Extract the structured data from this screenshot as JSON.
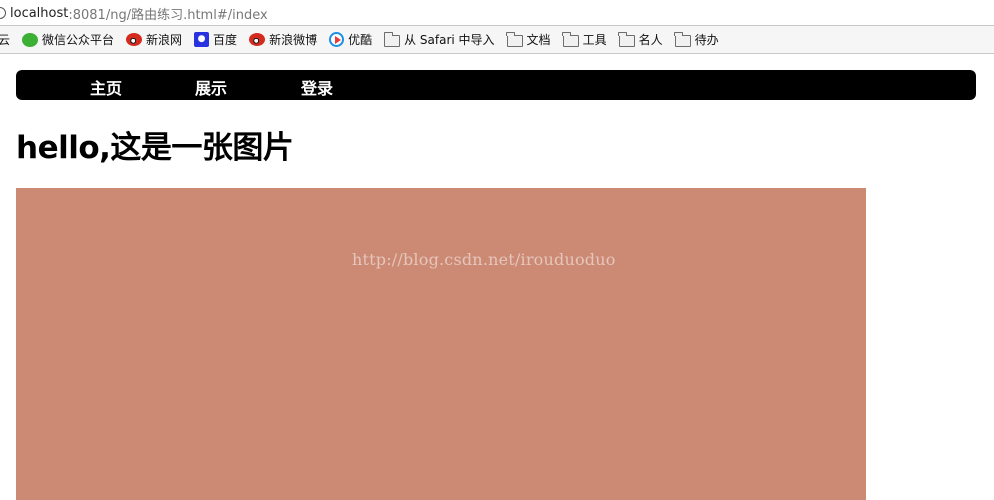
{
  "browser": {
    "url_host": "localhost",
    "url_rest": ":8081/ng/路由练习.html#/index"
  },
  "bookmarks": [
    {
      "label": "云",
      "icon": "cloud-icon"
    },
    {
      "label": "微信公众平台",
      "icon": "wechat-icon"
    },
    {
      "label": "新浪网",
      "icon": "weibo-icon"
    },
    {
      "label": "百度",
      "icon": "baidu-icon"
    },
    {
      "label": "新浪微博",
      "icon": "weibo-icon"
    },
    {
      "label": "优酷",
      "icon": "youku-icon"
    },
    {
      "label": "从 Safari 中导入",
      "icon": "folder-icon"
    },
    {
      "label": "文档",
      "icon": "folder-icon"
    },
    {
      "label": "工具",
      "icon": "folder-icon"
    },
    {
      "label": "名人",
      "icon": "folder-icon"
    },
    {
      "label": "待办",
      "icon": "folder-icon"
    }
  ],
  "nav": {
    "home": "主页",
    "show": "展示",
    "login": "登录"
  },
  "page": {
    "heading": "hello,这是一张图片",
    "image_color": "#cc8a75",
    "watermark": "http://blog.csdn.net/irouduoduo"
  }
}
